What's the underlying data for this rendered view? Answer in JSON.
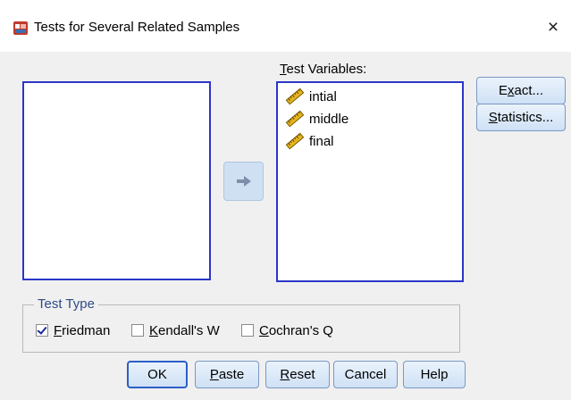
{
  "window": {
    "title": "Tests for Several Related Samples",
    "close_glyph": "×"
  },
  "source_list": {
    "items": []
  },
  "test_variables": {
    "label_underlined": "T",
    "label_rest": "est Variables:",
    "items": [
      {
        "label": "intial",
        "icon": "ruler-scale-icon"
      },
      {
        "label": "middle",
        "icon": "ruler-scale-icon"
      },
      {
        "label": "final",
        "icon": "ruler-scale-icon"
      }
    ]
  },
  "move_button": {
    "icon": "arrow-right-icon"
  },
  "side_buttons": {
    "exact": {
      "pre": "E",
      "underlined": "x",
      "post": "act..."
    },
    "statistics": {
      "pre": "",
      "underlined": "S",
      "post": "tatistics..."
    }
  },
  "test_type": {
    "legend": "Test Type",
    "friedman": {
      "underlined": "F",
      "rest": "riedman",
      "checked": true
    },
    "kendall": {
      "underlined": "K",
      "rest": "endall's W",
      "checked": false
    },
    "cochran": {
      "underlined": "C",
      "rest": "ochran's Q",
      "checked": false
    }
  },
  "buttons": {
    "ok": "OK",
    "paste": {
      "underlined": "P",
      "rest": "aste"
    },
    "reset": {
      "underlined": "R",
      "rest": "eset"
    },
    "cancel": "Cancel",
    "help": "Help"
  },
  "colors": {
    "list_border": "#2b36c9",
    "button_border": "#7a98c3",
    "legend_text": "#2f4a86"
  }
}
